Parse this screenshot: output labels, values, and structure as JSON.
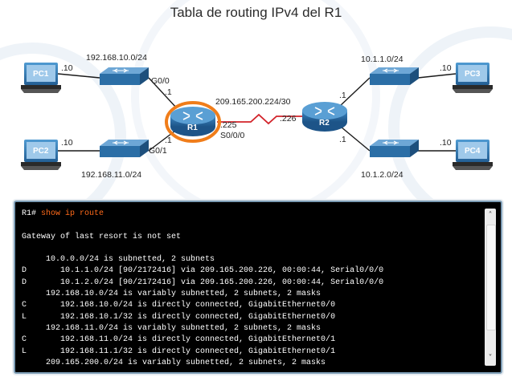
{
  "title": "Tabla de routing IPv4 del R1",
  "devices": {
    "pc1": "PC1",
    "pc2": "PC2",
    "pc3": "PC3",
    "pc4": "PC4",
    "r1": "R1",
    "r2": "R2"
  },
  "labels": {
    "net_pc1": "192.168.10.0/24",
    "net_pc2": "192.168.11.0/24",
    "net_pc3": "10.1.1.0/24",
    "net_pc4": "10.1.2.0/24",
    "wan_net": "209.165.200.224/30",
    "pc1_host": ".10",
    "pc2_host": ".10",
    "pc3_host": ".10",
    "pc4_host": ".10",
    "r1_g00": "G0/0",
    "r1_g00_ip": ".1",
    "r1_g01": "G0/1",
    "r1_g01_ip": ".1",
    "r1_s000_ip": ".225",
    "r1_s000": "S0/0/0",
    "r2_s_ip": ".226",
    "r2_top_ip": ".1",
    "r2_bottom_ip": ".1"
  },
  "terminal": {
    "prompt": "R1# ",
    "command": "show ip route",
    "lines": [
      "",
      "Gateway of last resort is not set",
      "",
      "     10.0.0.0/24 is subnetted, 2 subnets",
      "D       10.1.1.0/24 [90/2172416] via 209.165.200.226, 00:00:44, Serial0/0/0",
      "D       10.1.2.0/24 [90/2172416] via 209.165.200.226, 00:00:44, Serial0/0/0",
      "     192.168.10.0/24 is variably subnetted, 2 subnets, 2 masks",
      "C       192.168.10.0/24 is directly connected, GigabitEthernet0/0",
      "L       192.168.10.1/32 is directly connected, GigabitEthernet0/0",
      "     192.168.11.0/24 is variably subnetted, 2 subnets, 2 masks",
      "C       192.168.11.0/24 is directly connected, GigabitEthernet0/1",
      "L       192.168.11.1/32 is directly connected, GigabitEthernet0/1",
      "     209.165.200.0/24 is variably subnetted, 2 subnets, 2 masks"
    ]
  },
  "colors": {
    "device_blue": "#2b78b3",
    "highlight_orange": "#f07d1a",
    "serial_red": "#d2232a",
    "command_orange": "#ff6a1a"
  },
  "icons": {
    "scroll_up": "chevron-up-icon",
    "scroll_down": "chevron-down-icon"
  }
}
